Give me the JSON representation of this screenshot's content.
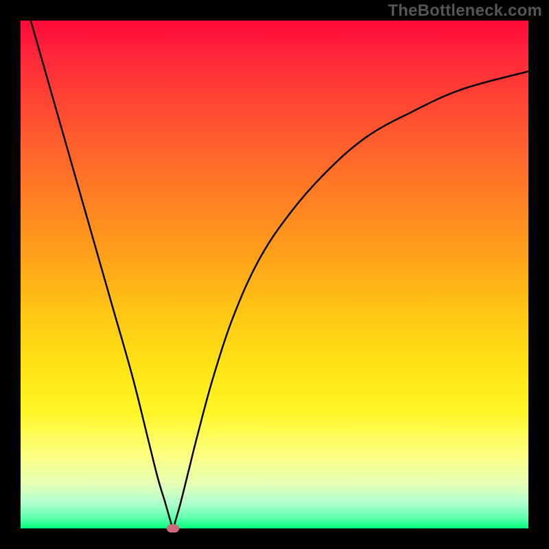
{
  "watermark": "TheBottleneck.com",
  "chart_data": {
    "type": "line",
    "title": "",
    "xlabel": "",
    "ylabel": "",
    "xlim": [
      0,
      100
    ],
    "ylim": [
      0,
      100
    ],
    "gradient_stops": [
      {
        "pos": 0,
        "color": "#ff0a3a"
      },
      {
        "pos": 8,
        "color": "#ff2b3a"
      },
      {
        "pos": 20,
        "color": "#ff5230"
      },
      {
        "pos": 33,
        "color": "#ff7a25"
      },
      {
        "pos": 47,
        "color": "#ffa319"
      },
      {
        "pos": 58,
        "color": "#ffc814"
      },
      {
        "pos": 68,
        "color": "#ffe315"
      },
      {
        "pos": 77,
        "color": "#fff625"
      },
      {
        "pos": 85,
        "color": "#feff7c"
      },
      {
        "pos": 91,
        "color": "#e7ffb3"
      },
      {
        "pos": 95,
        "color": "#b0ffcf"
      },
      {
        "pos": 98,
        "color": "#5cffad"
      },
      {
        "pos": 100,
        "color": "#00ff7a"
      }
    ],
    "series": [
      {
        "name": "bottleneck-curve",
        "x": [
          2,
          6,
          10,
          14,
          18,
          22,
          25,
          27,
          28.5,
          29.5,
          30,
          30.5,
          31.5,
          33,
          35,
          38,
          42,
          47,
          53,
          60,
          68,
          77,
          87,
          100
        ],
        "y": [
          100,
          86,
          72,
          58,
          44,
          30,
          18,
          10,
          5,
          1.5,
          0,
          1.5,
          5,
          11,
          19,
          30,
          42,
          53,
          62,
          70,
          77,
          82,
          86.5,
          90
        ]
      }
    ],
    "minimum_point": {
      "x": 30,
      "y": 0
    }
  }
}
